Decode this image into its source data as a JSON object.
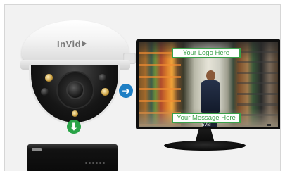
{
  "camera": {
    "brand": "InVid"
  },
  "monitor": {
    "brand": "InVid",
    "overlay_top": "Your Logo Here",
    "overlay_bottom": "Your Message Here"
  },
  "arrows": {
    "right": "➜",
    "down": "⬇"
  },
  "colors": {
    "overlay_green": "#3aa24a",
    "arrow_blue": "#1f7fc4",
    "arrow_green": "#2aa447"
  }
}
